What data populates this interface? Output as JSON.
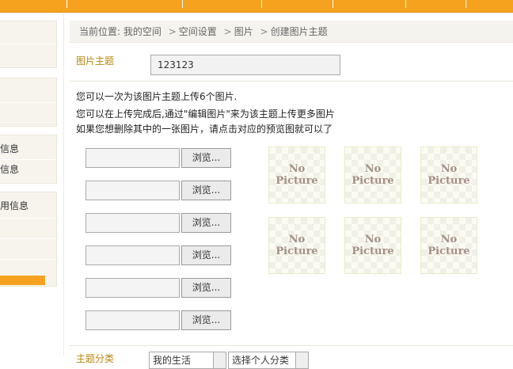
{
  "breadcrumb": {
    "prefix": "当前位置:",
    "items": [
      "我的空间",
      "空间设置",
      "图片",
      "创建图片主题"
    ],
    "separator": ">"
  },
  "theme": {
    "label": "图片主题",
    "value": "123123"
  },
  "info": {
    "line1": "您可以一次为该图片主题上传6个图片.",
    "line2": "您可以在上传完成后,通过\"编辑图片\"来为该主题上传更多图片",
    "line3": "如果您想删除其中的一张图片，请点击对应的预览图就可以了"
  },
  "uploads": {
    "browse_label": "浏览..."
  },
  "preview": {
    "placeholder_line1": "No",
    "placeholder_line2": "Picture"
  },
  "sidebar": {
    "items": [
      "信息",
      "信息",
      "用信息"
    ]
  },
  "category": {
    "label": "主题分类",
    "select1": "我的生活",
    "select2": "选择个人分类"
  },
  "colors": {
    "accent": "#f7a21f",
    "label": "#b8860b"
  }
}
